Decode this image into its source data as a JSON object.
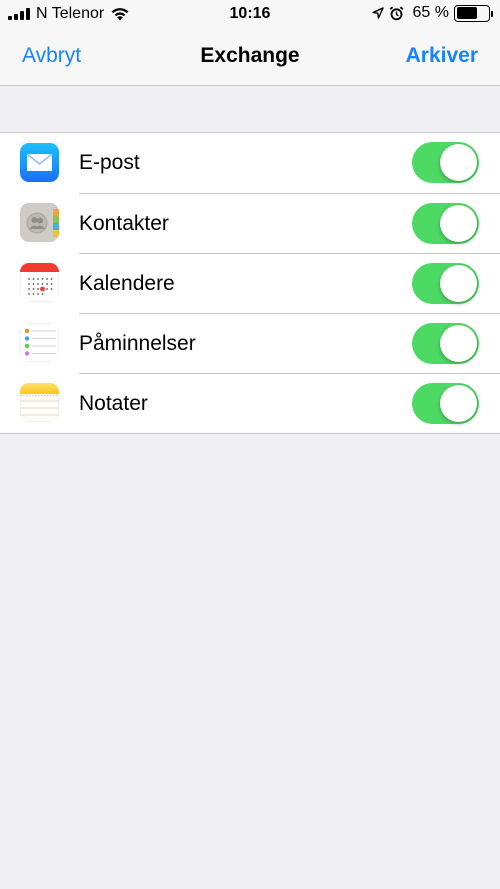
{
  "status_bar": {
    "carrier": "N Telenor",
    "time": "10:16",
    "battery_percent": "65 %",
    "battery_level": 0.65
  },
  "nav": {
    "cancel_label": "Avbryt",
    "title": "Exchange",
    "save_label": "Arkiver"
  },
  "accent_color": "#1a82fb",
  "toggle_on_color": "#4cd964",
  "items": [
    {
      "label": "E-post",
      "icon": "mail-icon",
      "enabled": true
    },
    {
      "label": "Kontakter",
      "icon": "contacts-icon",
      "enabled": true
    },
    {
      "label": "Kalendere",
      "icon": "calendar-icon",
      "enabled": true
    },
    {
      "label": "Påminnelser",
      "icon": "reminders-icon",
      "enabled": true
    },
    {
      "label": "Notater",
      "icon": "notes-icon",
      "enabled": true
    }
  ]
}
